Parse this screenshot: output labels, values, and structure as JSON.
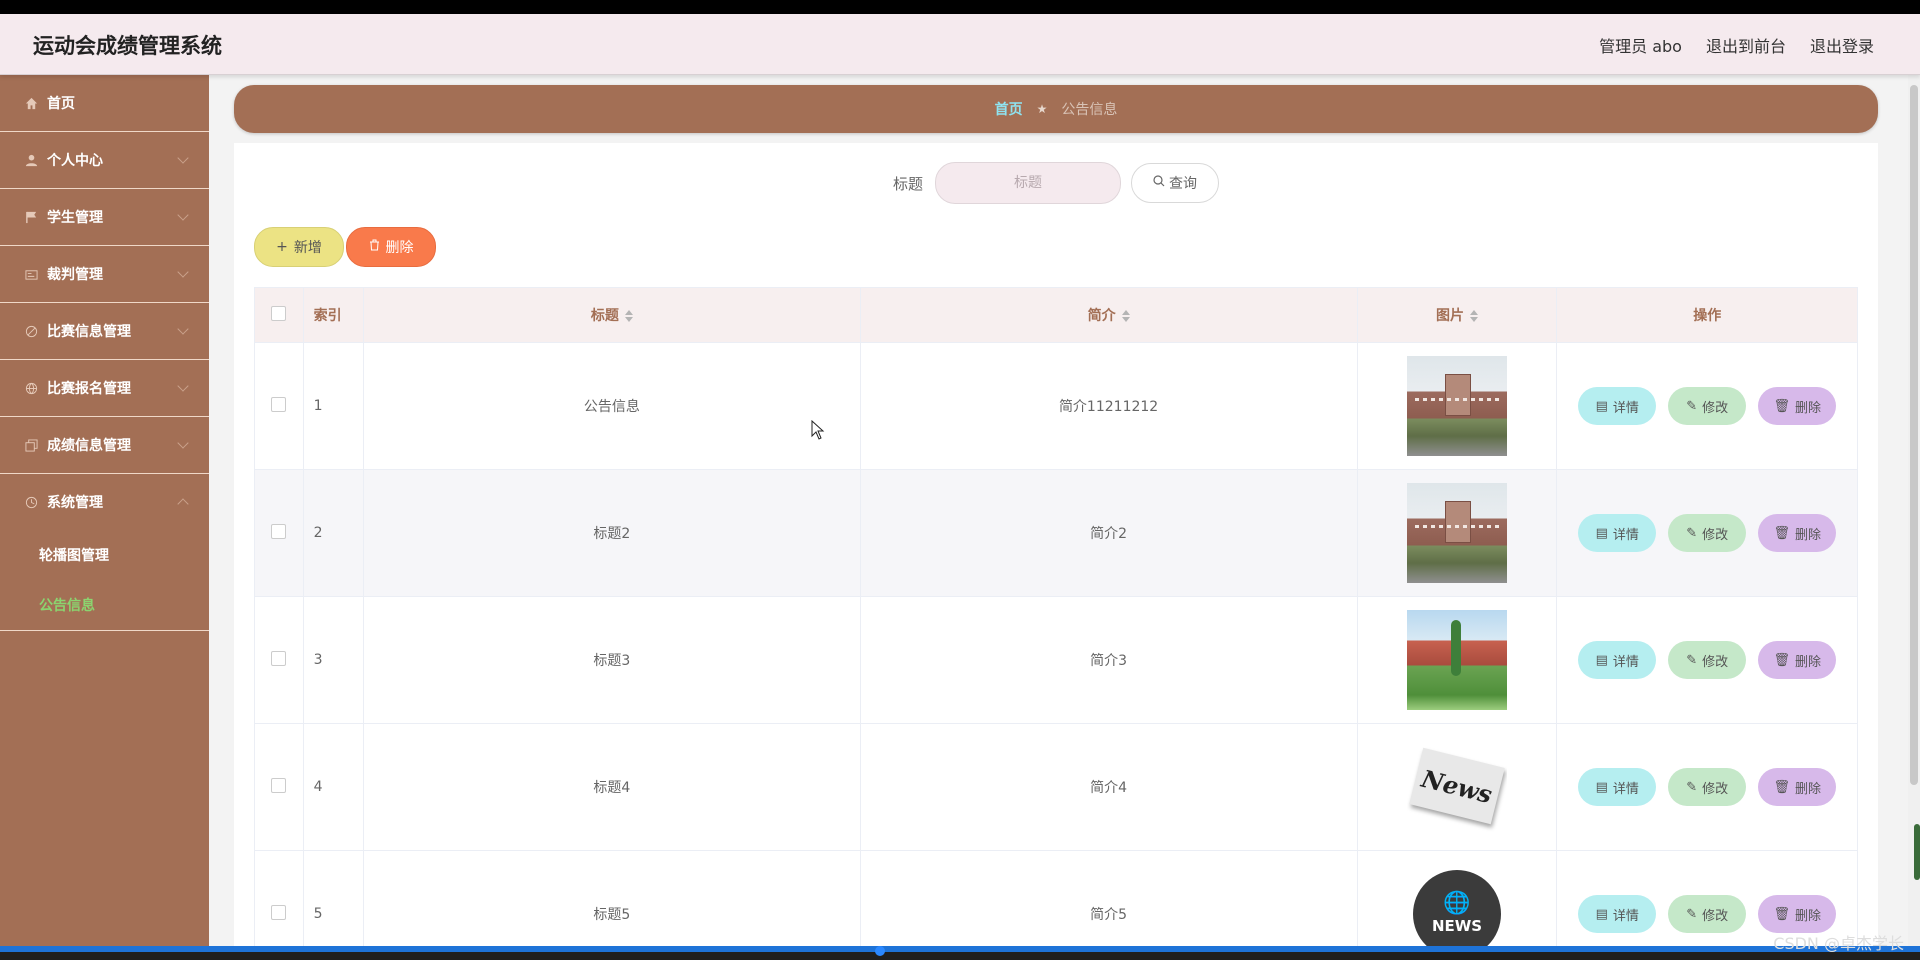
{
  "header": {
    "title": "运动会成绩管理系统",
    "admin": "管理员 abo",
    "to_front": "退出到前台",
    "logout": "退出登录"
  },
  "sidebar": {
    "items": [
      {
        "label": "首页",
        "icon": "home-icon"
      },
      {
        "label": "个人中心",
        "icon": "user-icon"
      },
      {
        "label": "学生管理",
        "icon": "flag-icon"
      },
      {
        "label": "裁判管理",
        "icon": "card-icon"
      },
      {
        "label": "比赛信息管理",
        "icon": "disabled-icon"
      },
      {
        "label": "比赛报名管理",
        "icon": "ball-icon"
      },
      {
        "label": "成绩信息管理",
        "icon": "copy-icon"
      },
      {
        "label": "系统管理",
        "icon": "clock-icon"
      }
    ],
    "sub_items": [
      {
        "label": "轮播图管理"
      },
      {
        "label": "公告信息"
      }
    ]
  },
  "breadcrumb": {
    "home": "首页",
    "current": "公告信息"
  },
  "search": {
    "label": "标题",
    "placeholder": "标题",
    "button": "查询"
  },
  "actions": {
    "add": "新增",
    "delete": "删除"
  },
  "table": {
    "headers": {
      "index": "索引",
      "title": "标题",
      "intro": "简介",
      "image": "图片",
      "ops": "操作"
    },
    "rows": [
      {
        "index": "1",
        "title": "公告信息",
        "intro": "简介11211212",
        "image": "school-building"
      },
      {
        "index": "2",
        "title": "标题2",
        "intro": "简介2",
        "image": "school-building"
      },
      {
        "index": "3",
        "title": "标题3",
        "intro": "简介3",
        "image": "campus"
      },
      {
        "index": "4",
        "title": "标题4",
        "intro": "简介4",
        "image": "newspaper",
        "image_text": "News"
      },
      {
        "index": "5",
        "title": "标题5",
        "intro": "简介5",
        "image": "globe",
        "image_text": "NEWS"
      }
    ],
    "op_labels": {
      "detail": "详情",
      "edit": "修改",
      "delete": "删除"
    }
  },
  "watermark": "CSDN @卓杰学长",
  "colors": {
    "sidebar": "#a36f55",
    "header": "#f5eaee",
    "active_sub": "#8bd46f",
    "breadcrumb_home": "#8fe3f0",
    "add_button": "#ece384",
    "delete_button": "#f97a4b",
    "detail_button": "#b5eef0",
    "edit_button": "#c5e8c9",
    "row_delete_button": "#d7b9ea"
  }
}
